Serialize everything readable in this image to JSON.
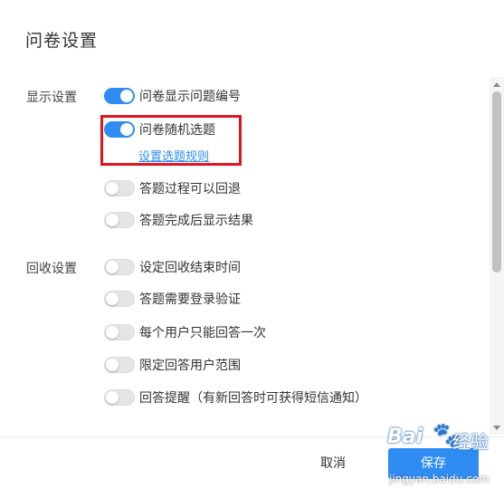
{
  "dialog": {
    "title": "问卷设置"
  },
  "display_settings": {
    "label": "显示设置",
    "items": [
      {
        "label": "问卷显示问题编号",
        "enabled": true
      },
      {
        "label": "问卷随机选题",
        "enabled": true,
        "link": "设置选题规则"
      },
      {
        "label": "答题过程可以回退",
        "enabled": false
      },
      {
        "label": "答题完成后显示结果",
        "enabled": false
      }
    ]
  },
  "collection_settings": {
    "label": "回收设置",
    "items": [
      {
        "label": "设定回收结束时间",
        "enabled": false
      },
      {
        "label": "答题需要登录验证",
        "enabled": false
      },
      {
        "label": "每个用户只能回答一次",
        "enabled": false
      },
      {
        "label": "限定回答用户范围",
        "enabled": false
      },
      {
        "label": "回答提醒（有新回答时可获得短信通知）",
        "enabled": false
      }
    ]
  },
  "footer": {
    "cancel_label": "取消",
    "save_label": "保存"
  },
  "watermark": {
    "brand": "Bai",
    "text": "经验",
    "url": "jingyan.baidu.com"
  },
  "colors": {
    "accent": "#2f8cf3",
    "highlight": "#e0141e",
    "toggle_off": "#e5e5e5"
  }
}
